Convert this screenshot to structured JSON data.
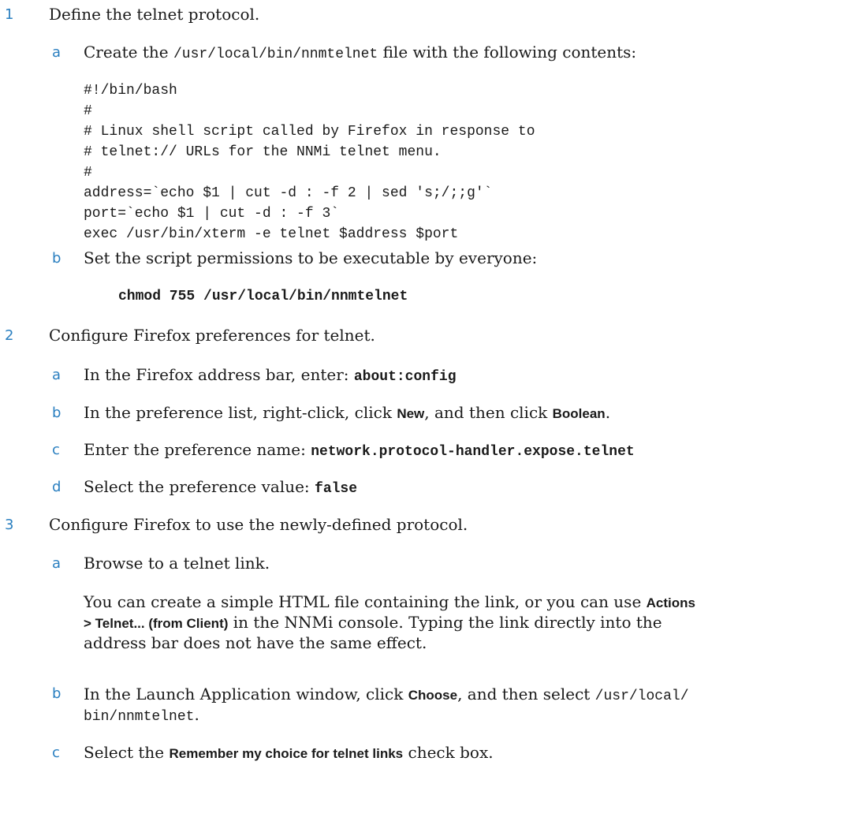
{
  "steps": {
    "s1": {
      "num": "1",
      "text": "Define the telnet protocol.",
      "a": {
        "letter": "a",
        "pre": "Create the ",
        "path": "/usr/local/bin/nnmtelnet",
        "post": " file with the following contents:"
      },
      "code_lines": [
        "#!/bin/bash",
        "#",
        "# Linux shell script called by Firefox in response to",
        "# telnet:// URLs for the NNMi telnet menu.",
        "#",
        "address=`echo $1 | cut -d : -f 2 | sed 's;/;;g'`",
        "port=`echo $1 | cut -d : -f 3`",
        "exec /usr/bin/xterm -e telnet $address $port"
      ],
      "b": {
        "letter": "b",
        "text": "Set the script permissions to be executable by everyone:"
      },
      "command": "chmod 755 /usr/local/bin/nnmtelnet"
    },
    "s2": {
      "num": "2",
      "text": "Configure Firefox preferences for telnet.",
      "a": {
        "letter": "a",
        "pre": "In the Firefox address bar, enter: ",
        "cmd": "about:config"
      },
      "b": {
        "letter": "b",
        "pre": "In the preference list, right-click, click ",
        "new": "New",
        "mid": ", and then click ",
        "boolean": "Boolean",
        "post": "."
      },
      "c": {
        "letter": "c",
        "pre": "Enter the preference name: ",
        "cmd": "network.protocol-handler.expose.telnet"
      },
      "d": {
        "letter": "d",
        "pre": "Select the preference value: ",
        "cmd": "false"
      }
    },
    "s3": {
      "num": "3",
      "text": "Configure Firefox to use the newly-defined protocol.",
      "a": {
        "letter": "a",
        "text": "Browse to a telnet link.",
        "para_pre": "You can create a simple HTML file containing the link, or you can use ",
        "actions": "Actions",
        "menu": "> Telnet... (from Client)",
        "para_post1": " in the NNMi console. Typing the link directly into the",
        "para_post2": "address bar does not have the same effect."
      },
      "b": {
        "letter": "b",
        "pre": "In the Launch Application window, click ",
        "choose": "Choose",
        "mid": ", and then select ",
        "path1": "/usr/local/",
        "path2": "bin/nnmtelnet",
        "post": "."
      },
      "c": {
        "letter": "c",
        "pre": "Select the ",
        "remember": "Remember my choice for telnet links",
        "post": " check box."
      }
    }
  }
}
